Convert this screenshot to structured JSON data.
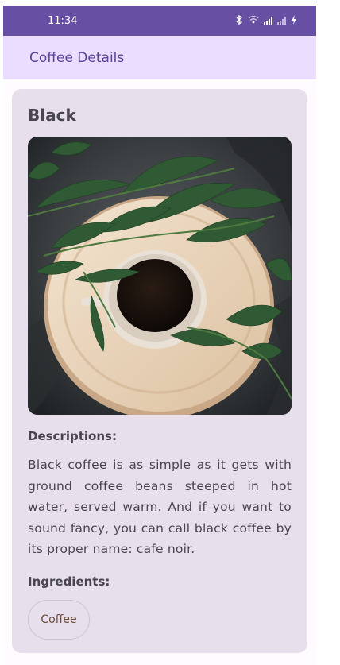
{
  "status_bar": {
    "time": "11:34",
    "icons": [
      "bluetooth-icon",
      "wifi-icon",
      "signal-icon",
      "signal-off-icon",
      "battery-charging-icon"
    ]
  },
  "app_bar": {
    "title": "Coffee Details"
  },
  "coffee": {
    "name": "Black",
    "descriptions_label": "Descriptions:",
    "description": "Black coffee is as simple as it gets with ground coffee beans steeped in hot water, served warm. And if you want to sound fancy, you can call black coffee by its proper name: cafe noir.",
    "ingredients_label": "Ingredients:",
    "ingredients": [
      "Coffee"
    ]
  },
  "colors": {
    "status_bar": "#6750a4",
    "app_bar": "#eaddff",
    "card": "#e7e0ec",
    "text": "#49454f"
  }
}
